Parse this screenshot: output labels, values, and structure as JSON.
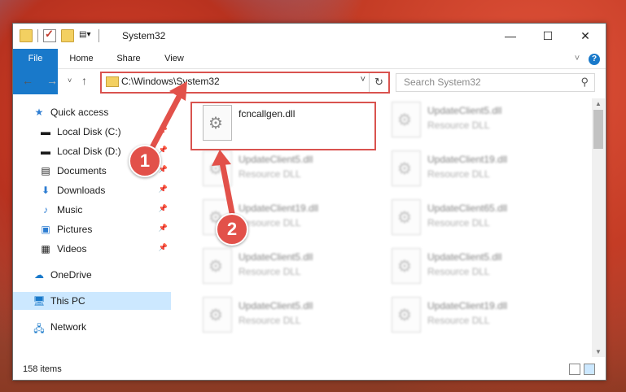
{
  "window": {
    "title": "System32"
  },
  "ribbon": {
    "tabs": [
      "File",
      "Home",
      "Share",
      "View"
    ]
  },
  "address": {
    "path": "C:\\Windows\\System32"
  },
  "search": {
    "placeholder": "Search System32"
  },
  "nav": {
    "items": [
      {
        "label": "Quick access",
        "icon": "star-icon"
      },
      {
        "label": "Local Disk (C:)",
        "icon": "drive-icon"
      },
      {
        "label": "Local Disk (D:)",
        "icon": "drive-icon"
      },
      {
        "label": "Documents",
        "icon": "documents-icon"
      },
      {
        "label": "Downloads",
        "icon": "download-icon"
      },
      {
        "label": "Music",
        "icon": "music-icon"
      },
      {
        "label": "Pictures",
        "icon": "pictures-icon"
      },
      {
        "label": "Videos",
        "icon": "videos-icon"
      },
      {
        "label": "OneDrive",
        "icon": "cloud-icon"
      },
      {
        "label": "This PC",
        "icon": "computer-icon"
      },
      {
        "label": "Network",
        "icon": "network-icon"
      }
    ]
  },
  "files": {
    "main": {
      "name": "fcncallgen.dll"
    },
    "blurred": [
      {
        "name": "UpdateClient5.dll",
        "type": "Resource DLL"
      },
      {
        "name": "UpdateClient5.dll",
        "type": "Resource DLL"
      },
      {
        "name": "UpdateClient19.dll",
        "type": "Resource DLL"
      },
      {
        "name": "UpdateClient19.dll",
        "type": "Resource DLL"
      },
      {
        "name": "UpdateClient65.dll",
        "type": "Resource DLL"
      },
      {
        "name": "UpdateClient5.dll",
        "type": "Resource DLL"
      },
      {
        "name": "UpdateClient5.dll",
        "type": "Resource DLL"
      },
      {
        "name": "UpdateClient5.dll",
        "type": "Resource DLL"
      },
      {
        "name": "UpdateClient19.dll",
        "type": "Resource DLL"
      }
    ]
  },
  "status": {
    "count": "158 items"
  },
  "annotations": {
    "one": "1",
    "two": "2"
  }
}
